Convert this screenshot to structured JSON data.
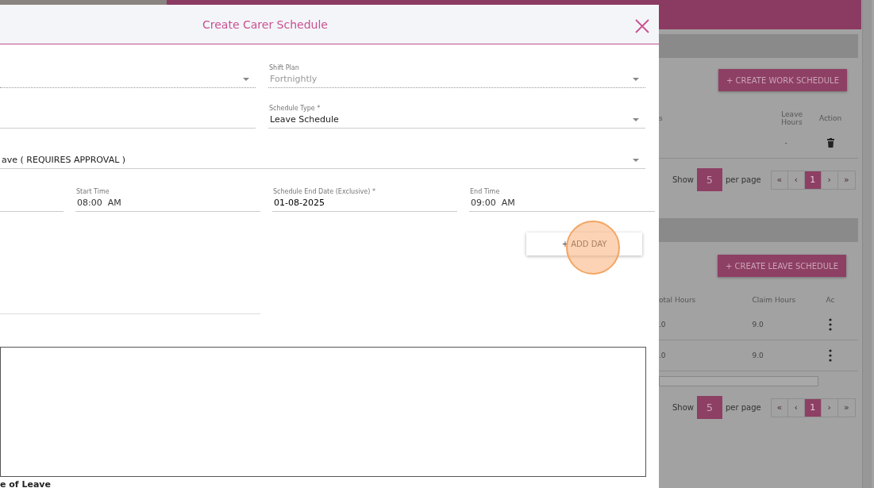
{
  "dialog": {
    "title": "Create Carer Schedule",
    "fields": [
      {
        "kind": "select",
        "disabled": true,
        "full_width": false
      },
      {
        "kind": "select",
        "label": "Shift Plan",
        "value": "Fortnightly",
        "disabled": true,
        "full_width": false
      },
      {
        "kind": "text",
        "disabled": false,
        "full_width": false
      },
      {
        "kind": "select",
        "label": "Schedule Type *",
        "value": "Leave Schedule",
        "disabled": false,
        "full_width": false
      },
      {
        "kind": "select",
        "value": "ave ( REQUIRES APPROVAL )",
        "disabled": false,
        "full_width": true
      }
    ],
    "time_fields": [
      {
        "kind": "blank"
      },
      {
        "kind": "time",
        "label": "Start Time",
        "value": "08:00  AM"
      },
      {
        "kind": "date",
        "label": "Schedule End Date (Exclusive) *",
        "value": "01-08-2025"
      },
      {
        "kind": "time",
        "label": "End Time",
        "value": "09:00  AM"
      }
    ],
    "add_day_button": "+ ADD DAY",
    "click_highlight": true,
    "section_label": "e of Leave"
  },
  "background": {
    "sections": [
      {
        "create_button": "+ CREATE WORK SCHEDULE",
        "columns": [
          "s",
          "Leave Hours",
          "Action"
        ],
        "rows": [
          {
            "kind": "delete",
            "cells": [
              "",
              "-"
            ]
          }
        ],
        "scrollbar": false,
        "per_page": "5",
        "show": "Show",
        "per_page_label": "per page",
        "pages": [
          {
            "label": "«",
            "selected": false
          },
          {
            "label": "‹",
            "selected": false
          },
          {
            "label": "1",
            "selected": true
          },
          {
            "label": "›",
            "selected": false
          },
          {
            "label": "»",
            "selected": false
          }
        ]
      },
      {
        "create_button": "+ CREATE LEAVE SCHEDULE",
        "columns": [
          "otal Hours",
          "Claim Hours",
          "Ac"
        ],
        "rows": [
          {
            "kind": "menu",
            "cells": [
              ".0",
              "9.0"
            ]
          },
          {
            "kind": "menu",
            "cells": [
              ".0",
              "9.0"
            ]
          }
        ],
        "scrollbar": true,
        "per_page": "5",
        "show": "Show",
        "per_page_label": "per page",
        "pages": [
          {
            "label": "«",
            "selected": false
          },
          {
            "label": "‹",
            "selected": false
          },
          {
            "label": "1",
            "selected": true
          },
          {
            "label": "›",
            "selected": false
          },
          {
            "label": "»",
            "selected": false
          }
        ]
      }
    ]
  }
}
